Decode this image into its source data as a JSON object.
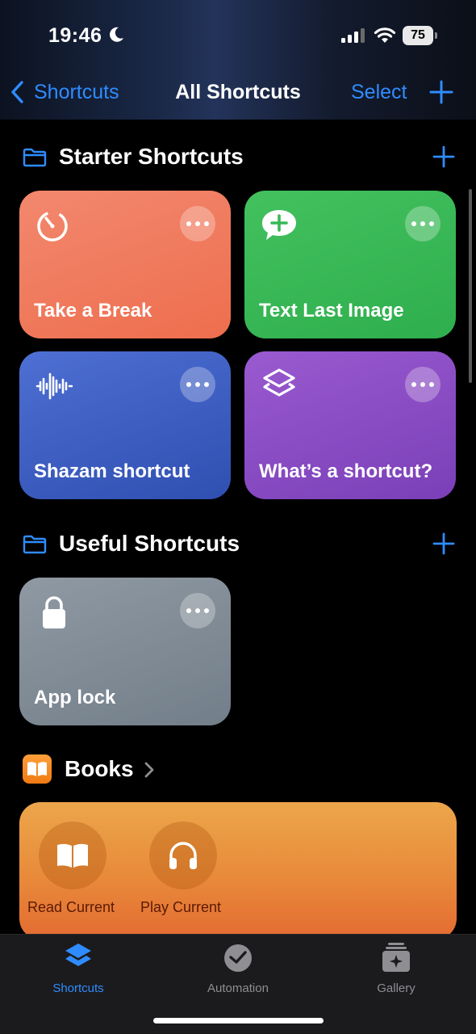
{
  "status_bar": {
    "time": "19:46",
    "battery": "75"
  },
  "nav": {
    "back_label": "Shortcuts",
    "title": "All Shortcuts",
    "select_label": "Select"
  },
  "sections": [
    {
      "title": "Starter Shortcuts",
      "cards": [
        {
          "label": "Take a Break",
          "icon": "timer-icon",
          "color": "#ef775a"
        },
        {
          "label": "Text Last Image",
          "icon": "message-plus-icon",
          "color": "#38b856"
        },
        {
          "label": "Shazam shortcut",
          "icon": "waveform-icon",
          "color": "#3f5fc4"
        },
        {
          "label": "What’s a shortcut?",
          "icon": "shortcuts-layers-icon",
          "color": "#8a4cc4"
        }
      ]
    },
    {
      "title": "Useful Shortcuts",
      "cards": [
        {
          "label": "App lock",
          "icon": "lock-icon",
          "color": "#818b95"
        }
      ]
    }
  ],
  "books": {
    "title": "Books",
    "actions": [
      {
        "label": "Read Current",
        "icon": "book-icon"
      },
      {
        "label": "Play Current",
        "icon": "headphones-icon"
      }
    ]
  },
  "tabbar": {
    "items": [
      {
        "label": "Shortcuts",
        "icon": "shortcuts-icon",
        "active": true
      },
      {
        "label": "Automation",
        "icon": "clock-check-icon",
        "active": false
      },
      {
        "label": "Gallery",
        "icon": "gallery-icon",
        "active": false
      }
    ]
  },
  "colors": {
    "accent": "#2f8cff",
    "background": "#000000",
    "tabbar": "#1b1b1d"
  }
}
